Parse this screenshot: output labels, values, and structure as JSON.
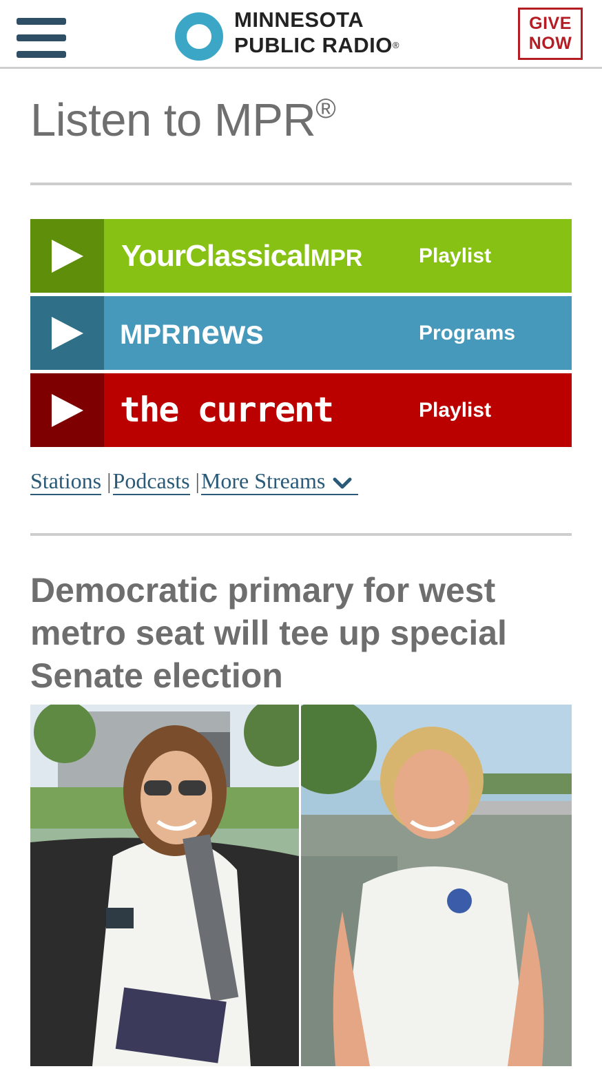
{
  "header": {
    "logo_line1": "MINNESOTA",
    "logo_line2": "PUBLIC RADIO",
    "logo_reg": "®",
    "give_line1": "GIVE",
    "give_line2": "NOW",
    "menu_icon": "hamburger-menu-icon"
  },
  "listen": {
    "title": "Listen to MPR",
    "reg": "®"
  },
  "streams": [
    {
      "brand_main": "YourClassical",
      "brand_suffix": "MPR",
      "link": "Playlist",
      "color": "#86c113",
      "play_color": "#5f8f0a",
      "icon": "play-icon"
    },
    {
      "brand_prefix": "MPR",
      "brand_main": "news",
      "link": "Programs",
      "color": "#4699ba",
      "play_color": "#2f6f88",
      "icon": "play-icon"
    },
    {
      "brand_main": "the current",
      "link": "Playlist",
      "color": "#bb0000",
      "play_color": "#7e0000",
      "icon": "play-icon"
    }
  ],
  "sublinks": {
    "stations": "Stations",
    "podcasts": "Podcasts",
    "more_streams": "More Streams",
    "separator": "|",
    "chevron_icon": "chevron-down-icon"
  },
  "article": {
    "headline": "Democratic primary for west metro seat will tee up special Senate election"
  },
  "colors": {
    "header_border": "#cfcfcf",
    "logo_ring": "#3ca6c6",
    "give_red": "#b31d23",
    "link_blue": "#2a5a78",
    "text_gray": "#6e6e6e"
  }
}
